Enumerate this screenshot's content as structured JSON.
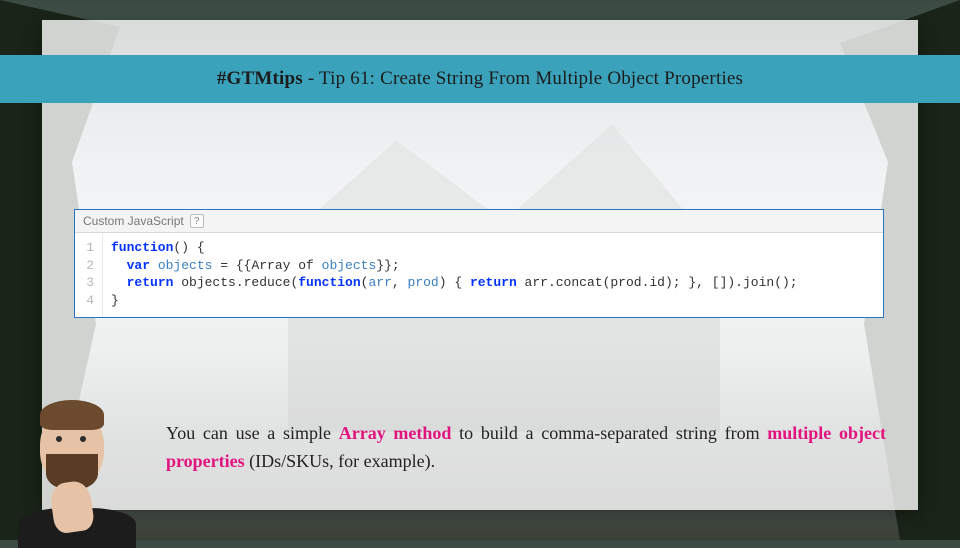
{
  "title": {
    "hashtag": "#GTMtips",
    "rest": " - Tip 61: Create String From Multiple Object Properties"
  },
  "code": {
    "header_label": "Custom JavaScript",
    "help_char": "?",
    "line_numbers": [
      "1",
      "2",
      "3",
      "4"
    ],
    "lines": {
      "l1_kw": "function",
      "l1_rest": "() {",
      "l2_indent": "  ",
      "l2_kw": "var",
      "l2_sp": " ",
      "l2_var": "objects",
      "l2_mid": " = {{Array of ",
      "l2_var2": "objects",
      "l2_end": "}};",
      "l3_indent": "  ",
      "l3_kw": "return",
      "l3_a": " objects.reduce(",
      "l3_kw2": "function",
      "l3_b": "(",
      "l3_arg1": "arr",
      "l3_c": ", ",
      "l3_arg2": "prod",
      "l3_d": ") { ",
      "l3_kw3": "return",
      "l3_e": " arr.concat(prod.id); }, []).join();",
      "l4": "}"
    }
  },
  "caption": {
    "p1": "You can use a simple ",
    "hl1": "Array method",
    "p2": " to build a comma-separated string from ",
    "hl2": "multiple object properties",
    "p3": " (IDs/SKUs, for example)."
  }
}
